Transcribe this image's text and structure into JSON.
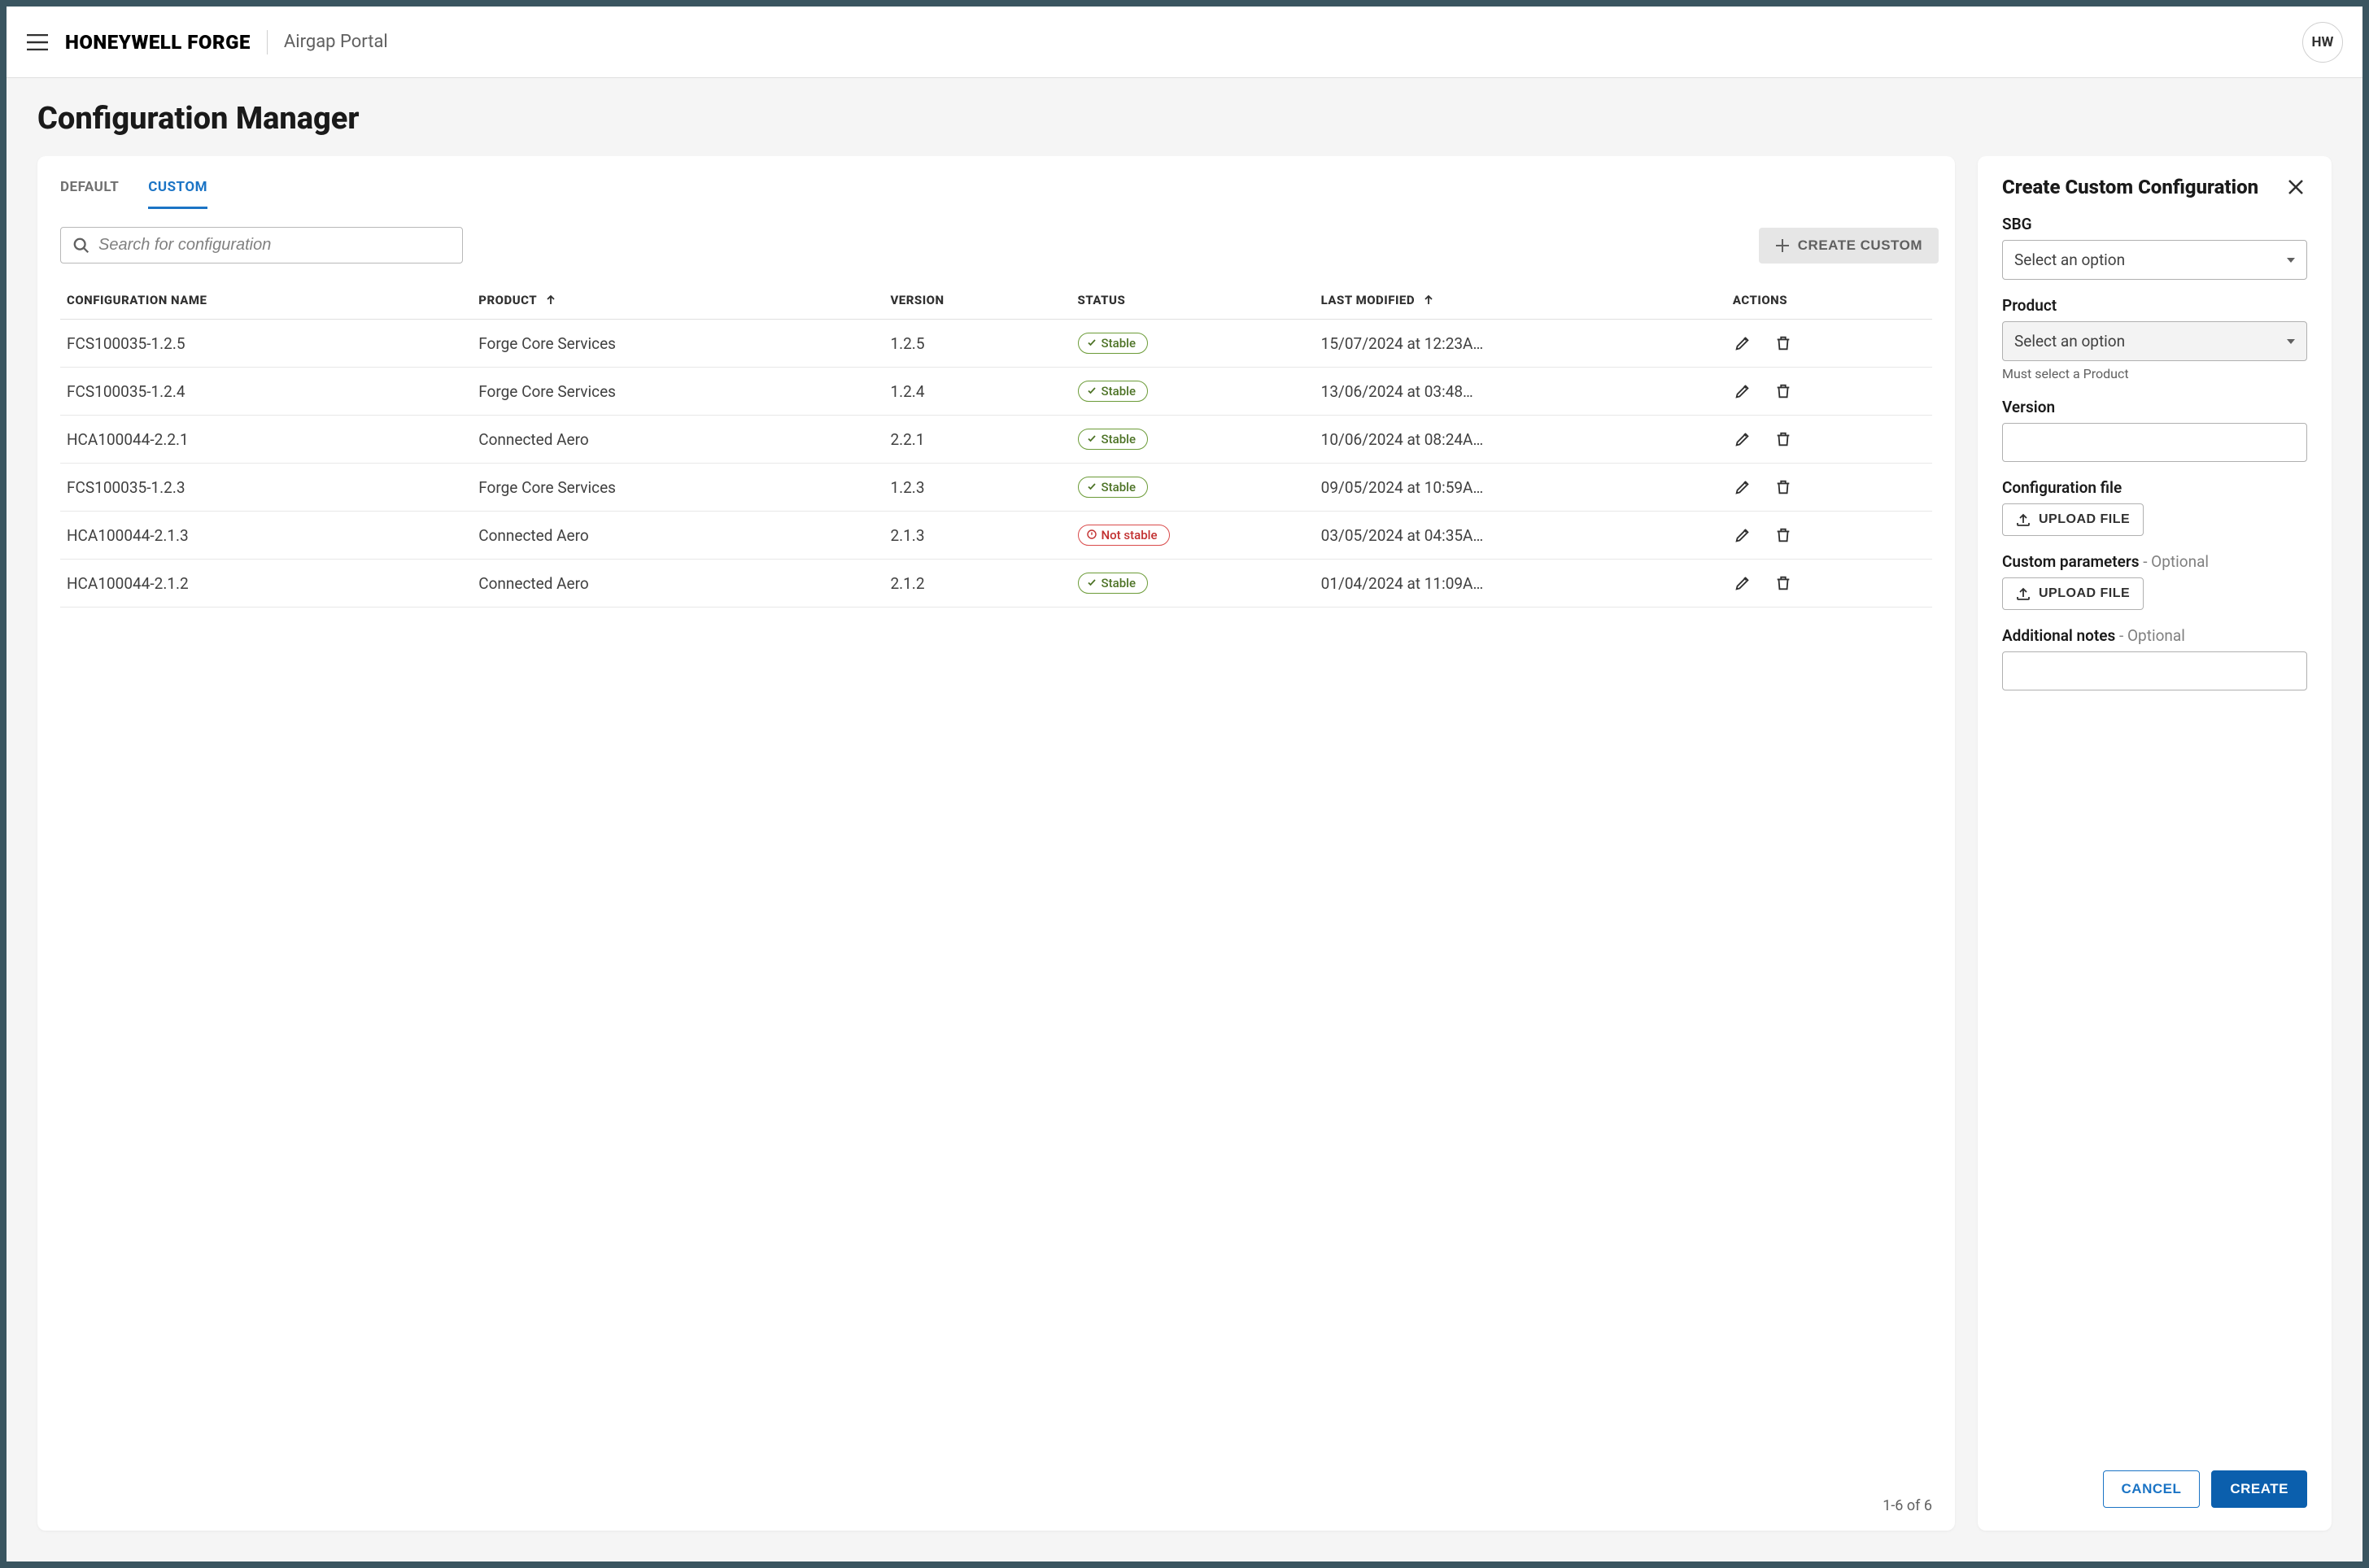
{
  "header": {
    "brand": "HONEYWELL FORGE",
    "sub_brand": "Airgap Portal",
    "avatar_initials": "HW"
  },
  "page": {
    "title": "Configuration Manager"
  },
  "tabs": {
    "default": "DEFAULT",
    "custom": "CUSTOM"
  },
  "toolbar": {
    "search_placeholder": "Search for configuration",
    "create_label": "CREATE CUSTOM"
  },
  "table": {
    "headers": {
      "name": "CONFIGURATION NAME",
      "product": "PRODUCT",
      "version": "VERSION",
      "status": "STATUS",
      "modified": "LAST MODIFIED",
      "actions": "ACTIONS"
    },
    "status_labels": {
      "stable": "Stable",
      "notstable": "Not stable"
    },
    "rows": [
      {
        "name": "FCS100035-1.2.5",
        "product": "Forge Core Services",
        "version": "1.2.5",
        "status": "stable",
        "modified": "15/07/2024 at 12:23A…"
      },
      {
        "name": "FCS100035-1.2.4",
        "product": "Forge Core Services",
        "version": "1.2.4",
        "status": "stable",
        "modified": "13/06/2024 at 03:48…"
      },
      {
        "name": "HCA100044-2.2.1",
        "product": "Connected Aero",
        "version": "2.2.1",
        "status": "stable",
        "modified": "10/06/2024 at 08:24A…"
      },
      {
        "name": "FCS100035-1.2.3",
        "product": "Forge Core Services",
        "version": "1.2.3",
        "status": "stable",
        "modified": "09/05/2024 at 10:59A…"
      },
      {
        "name": "HCA100044-2.1.3",
        "product": "Connected Aero",
        "version": "2.1.3",
        "status": "notstable",
        "modified": "03/05/2024 at 04:35A…"
      },
      {
        "name": "HCA100044-2.1.2",
        "product": "Connected Aero",
        "version": "2.1.2",
        "status": "stable",
        "modified": "01/04/2024 at 11:09A…"
      }
    ],
    "pagination": "1-6 of 6"
  },
  "panel": {
    "title": "Create Custom Configuration",
    "sbg_label": "SBG",
    "sbg_placeholder": "Select an option",
    "product_label": "Product",
    "product_placeholder": "Select an option",
    "product_helper": "Must select a Product",
    "version_label": "Version",
    "config_file_label": "Configuration file",
    "custom_params_label": "Custom parameters",
    "notes_label": "Additional notes",
    "optional_suffix": " - Optional",
    "upload_label": "UPLOAD FILE",
    "cancel_label": "CANCEL",
    "create_label": "CREATE"
  }
}
